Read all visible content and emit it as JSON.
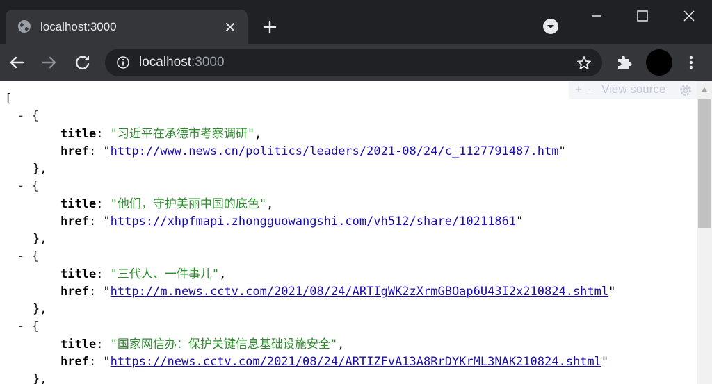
{
  "browser": {
    "tab_title": "localhost:3000",
    "url_host": "localhost",
    "url_port": ":3000",
    "icons": {
      "favicon": "globe-icon",
      "tab_close": "close-icon",
      "new_tab": "plus-icon",
      "tab_search": "chevron-down-icon",
      "back": "arrow-left-icon",
      "forward": "arrow-right-icon",
      "reload": "reload-icon",
      "site_info": "info-icon",
      "bookmark": "star-icon",
      "extensions": "puzzle-icon",
      "menu": "kebab-icon"
    }
  },
  "viewer": {
    "plus": "+",
    "minus": "-",
    "view_source": "View source"
  },
  "json": {
    "open_bracket": "[",
    "collapse_marker": "- {",
    "close_item": "},",
    "key_title": "title",
    "key_href": "href",
    "items": [
      {
        "title": "\"习近平在承德市考察调研\"",
        "href": "http://www.news.cn/politics/leaders/2021-08/24/c_1127791487.htm"
      },
      {
        "title": "\"他们，守护美丽中国的底色\"",
        "href": "https://xhpfmapi.zhongguowangshi.com/vh512/share/10211861"
      },
      {
        "title": "\"三代人、一件事儿\"",
        "href": "http://m.news.cctv.com/2021/08/24/ARTIgWK2zXrmGBOap6U43I2x210824.shtml"
      },
      {
        "title": "\"国家网信办：保护关键信息基础设施安全\"",
        "href": "https://news.cctv.com/2021/08/24/ARTIZFvA13A8RrDYKrML3NAK210824.shtml"
      }
    ]
  },
  "colors": {
    "tab_strip": "#202124",
    "toolbar": "#35363a",
    "json_string": "#2e8b2e",
    "json_link": "#1a0dab"
  }
}
